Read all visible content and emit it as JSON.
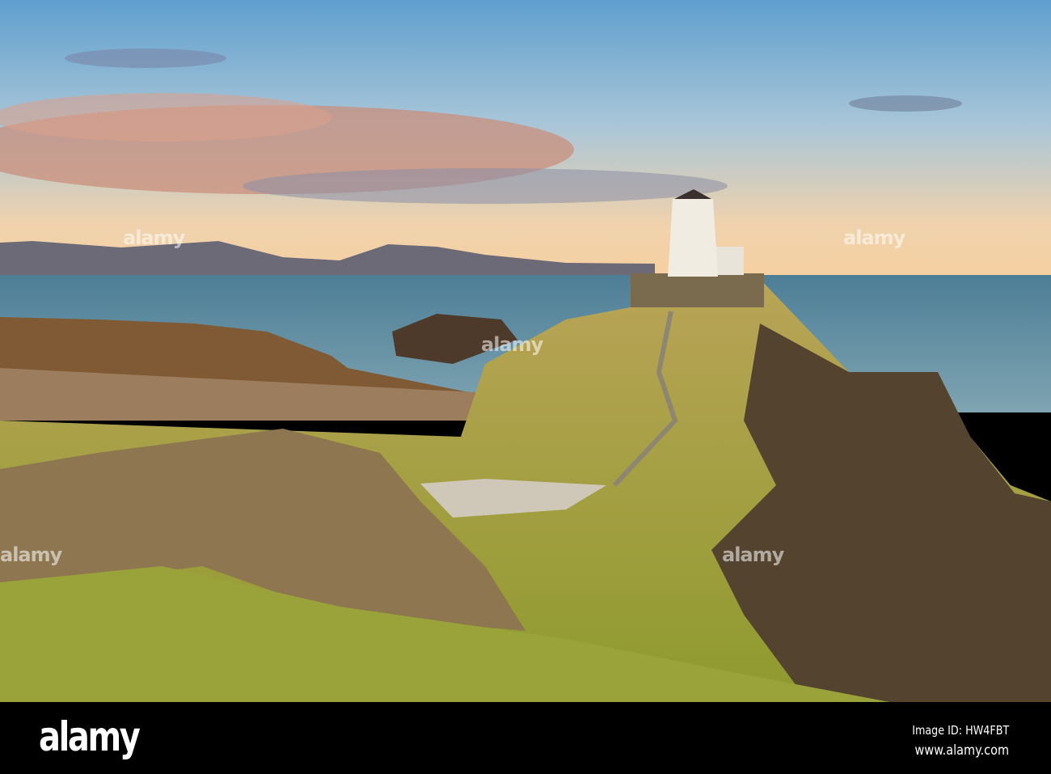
{
  "photo": {
    "subject": "lighthouse"
  },
  "watermark": {
    "text": "alamy"
  },
  "footer": {
    "logo": "alamy",
    "image_id": "Image ID: HW4FBT",
    "url": "www.alamy.com"
  },
  "colors": {
    "sky_top": "#5f9fce",
    "sea": "#3e6f86",
    "grass": "#a89a3a",
    "rock": "#5a4a35"
  }
}
